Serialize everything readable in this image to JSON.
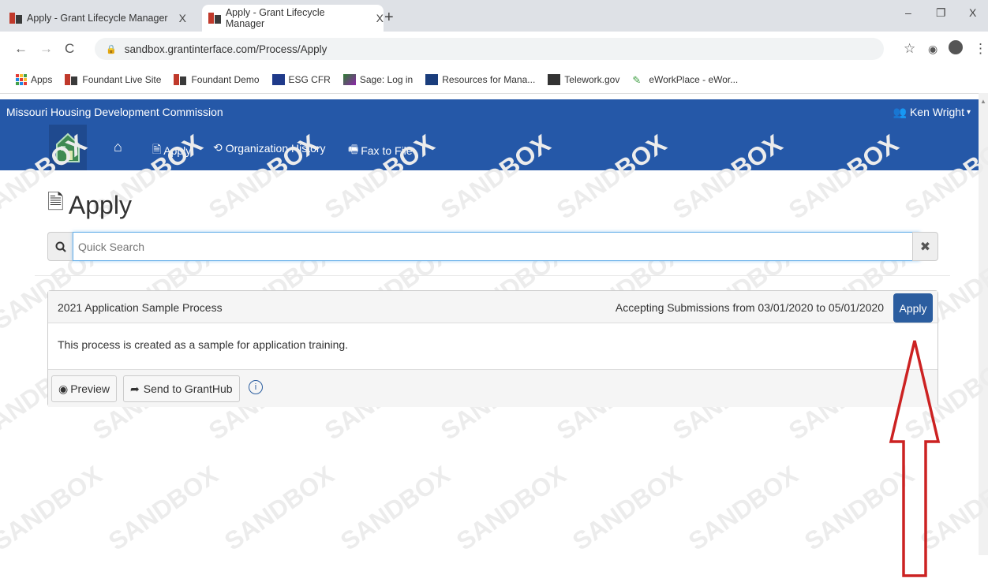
{
  "browser": {
    "tabs": [
      {
        "title": "Apply - Grant Lifecycle Manager",
        "close": "X"
      },
      {
        "title": "Apply - Grant Lifecycle Manager",
        "close": "X"
      }
    ],
    "new_tab": "+",
    "window_controls": {
      "minimize": "–",
      "restore": "❐",
      "close": "X"
    },
    "url": "sandbox.grantinterface.com/Process/Apply",
    "bookmarks": [
      "Apps",
      "Foundant Live Site",
      "Foundant Demo",
      "ESG CFR",
      "Sage: Log in",
      "Resources for Mana...",
      "Telework.gov",
      "eWorkPlace - eWor..."
    ]
  },
  "app": {
    "org_name": "Missouri Housing Development Commission",
    "user_name": "Ken Wright",
    "nav": {
      "apply": "Apply",
      "org_history": "Organization History",
      "fax": "Fax to File"
    },
    "watermark": "SANDBOX"
  },
  "page": {
    "title": "Apply",
    "search": {
      "placeholder": "Quick Search",
      "value": ""
    },
    "process": {
      "name": "2021 Application Sample Process",
      "submissions": "Accepting Submissions from 03/01/2020 to 05/01/2020",
      "apply_label": "Apply",
      "description": "This process is created as a sample for application training.",
      "preview_label": "Preview",
      "send_label": "Send to GrantHub"
    }
  },
  "colors": {
    "brand": "#2558a8",
    "apply_button": "#2b5d9f",
    "annotation_arrow": "#cc2222"
  }
}
